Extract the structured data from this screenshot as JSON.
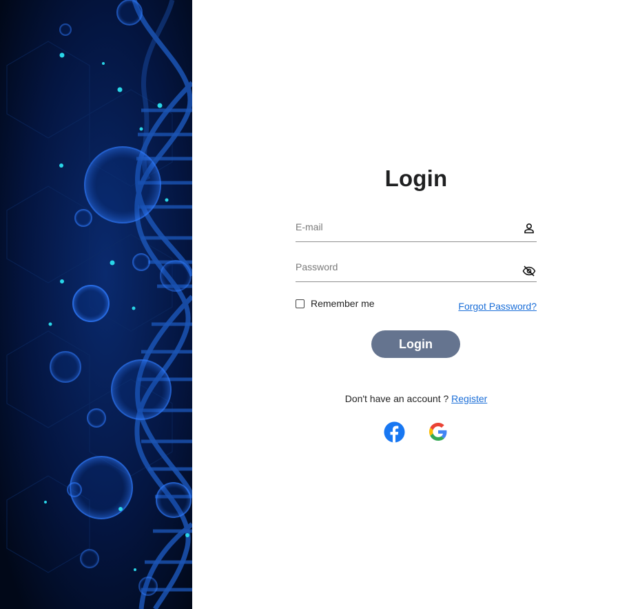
{
  "login": {
    "title": "Login",
    "email": {
      "placeholder": "E-mail",
      "value": "",
      "icon": "person-icon"
    },
    "password": {
      "placeholder": "Password",
      "value": "",
      "icon": "eye-off-icon"
    },
    "remember_label": "Remember me",
    "remember_checked": false,
    "forgot_label": "Forgot Password?",
    "submit_label": "Login",
    "register_prompt": "Don't have an account ?",
    "register_link": "Register",
    "social": [
      {
        "icon": "facebook-icon",
        "color": "#1877f2"
      },
      {
        "icon": "google-icon"
      }
    ]
  },
  "colors": {
    "button_bg": "#65748f",
    "link": "#1a6ed8",
    "side_bg": "#020d2a"
  }
}
